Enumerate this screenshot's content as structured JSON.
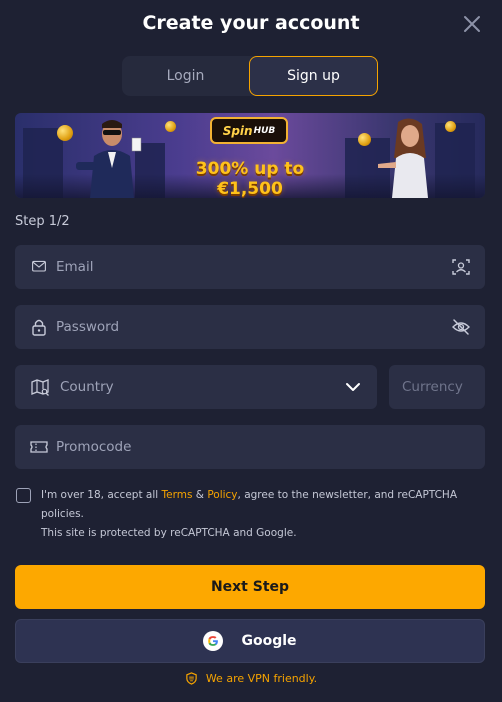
{
  "header": {
    "title": "Create your account"
  },
  "tabs": [
    {
      "label": "Login",
      "active": false
    },
    {
      "label": "Sign up",
      "active": true
    }
  ],
  "banner": {
    "brand_main": "Spin",
    "brand_sub": "HUB",
    "offer": "300% up to €1,500"
  },
  "form": {
    "step": "Step 1/2",
    "email_placeholder": "Email",
    "password_placeholder": "Password",
    "country_placeholder": "Country",
    "currency_placeholder": "Currency",
    "promocode_placeholder": "Promocode"
  },
  "consent": {
    "text_before": "I'm over 18, accept all ",
    "terms_link": "Terms",
    "amp": " & ",
    "policy_link": "Policy",
    "text_after": ", agree to the newsletter, and reCAPTCHA policies.",
    "recaptcha_note": "This site is protected by reCAPTCHA and Google."
  },
  "buttons": {
    "next": "Next Step",
    "google": "Google"
  },
  "footer": {
    "vpn": "We are VPN friendly."
  },
  "colors": {
    "background": "#1e2133",
    "field": "#2b2f45",
    "accent": "#fda800",
    "link": "#f5a300"
  },
  "icons": [
    "close-icon",
    "envelope-icon",
    "face-scan-icon",
    "lock-icon",
    "eye-off-icon",
    "map-icon",
    "chevron-down-icon",
    "ticket-icon",
    "google-icon",
    "shield-icon"
  ]
}
